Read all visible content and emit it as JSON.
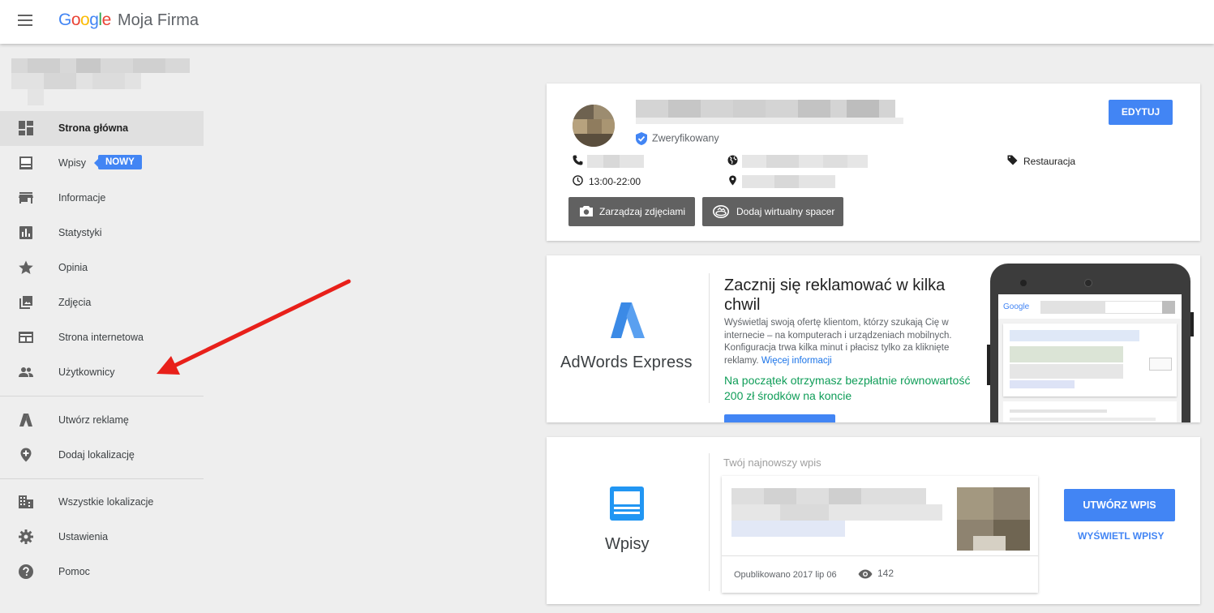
{
  "header": {
    "logo_letters": [
      "G",
      "o",
      "o",
      "g",
      "l",
      "e"
    ],
    "product_name": "Moja Firma"
  },
  "sidebar": {
    "items": [
      {
        "label": "Strona główna",
        "icon": "dashboard-icon",
        "active": true
      },
      {
        "label": "Wpisy",
        "icon": "posts-icon",
        "badge": "NOWY"
      },
      {
        "label": "Informacje",
        "icon": "store-icon"
      },
      {
        "label": "Statystyki",
        "icon": "insights-icon"
      },
      {
        "label": "Opinia",
        "icon": "star-icon"
      },
      {
        "label": "Zdjęcia",
        "icon": "photos-icon"
      },
      {
        "label": "Strona internetowa",
        "icon": "website-icon"
      },
      {
        "label": "Użytkownicy",
        "icon": "users-icon"
      },
      {
        "label": "Utwórz reklamę",
        "icon": "adwords-icon"
      },
      {
        "label": "Dodaj lokalizację",
        "icon": "add-location-icon"
      },
      {
        "label": "Wszystkie lokalizacje",
        "icon": "buildings-icon"
      },
      {
        "label": "Ustawienia",
        "icon": "gear-icon"
      },
      {
        "label": "Pomoc",
        "icon": "help-icon"
      }
    ]
  },
  "business_card": {
    "verified_label": "Zweryfikowany",
    "edit_label": "EDYTUJ",
    "hours": "13:00-22:00",
    "category": "Restauracja",
    "manage_photos_label": "Zarządzaj zdjęciami",
    "virtual_tour_label": "Dodaj wirtualny spacer"
  },
  "ads_card": {
    "brand": "AdWords Express",
    "title": "Zacznij się reklamować w kilka chwil",
    "description": "Wyświetlaj swoją ofertę klientom, którzy szukają Cię w internecie – na komputerach i urządzeniach mobilnych. Konfiguracja trwa kilka minut i płacisz tylko za kliknięte reklamy.",
    "more_link": "Więcej informacji",
    "promo": "Na początek otrzymasz bezpłatnie równowartość 200 zł środków na koncie",
    "phone_search_logo": "Google"
  },
  "posts_card": {
    "brand": "Wpisy",
    "subtitle": "Twój najnowszy wpis",
    "published": "Opublikowano 2017 lip 06",
    "views": "142",
    "create_label": "UTWÓRZ WPIS",
    "view_label": "WYŚWIETL WPISY"
  },
  "colors": {
    "accent": "#4285f4",
    "promo_green": "#0f9d58",
    "annotation_arrow": "#e8201a"
  }
}
